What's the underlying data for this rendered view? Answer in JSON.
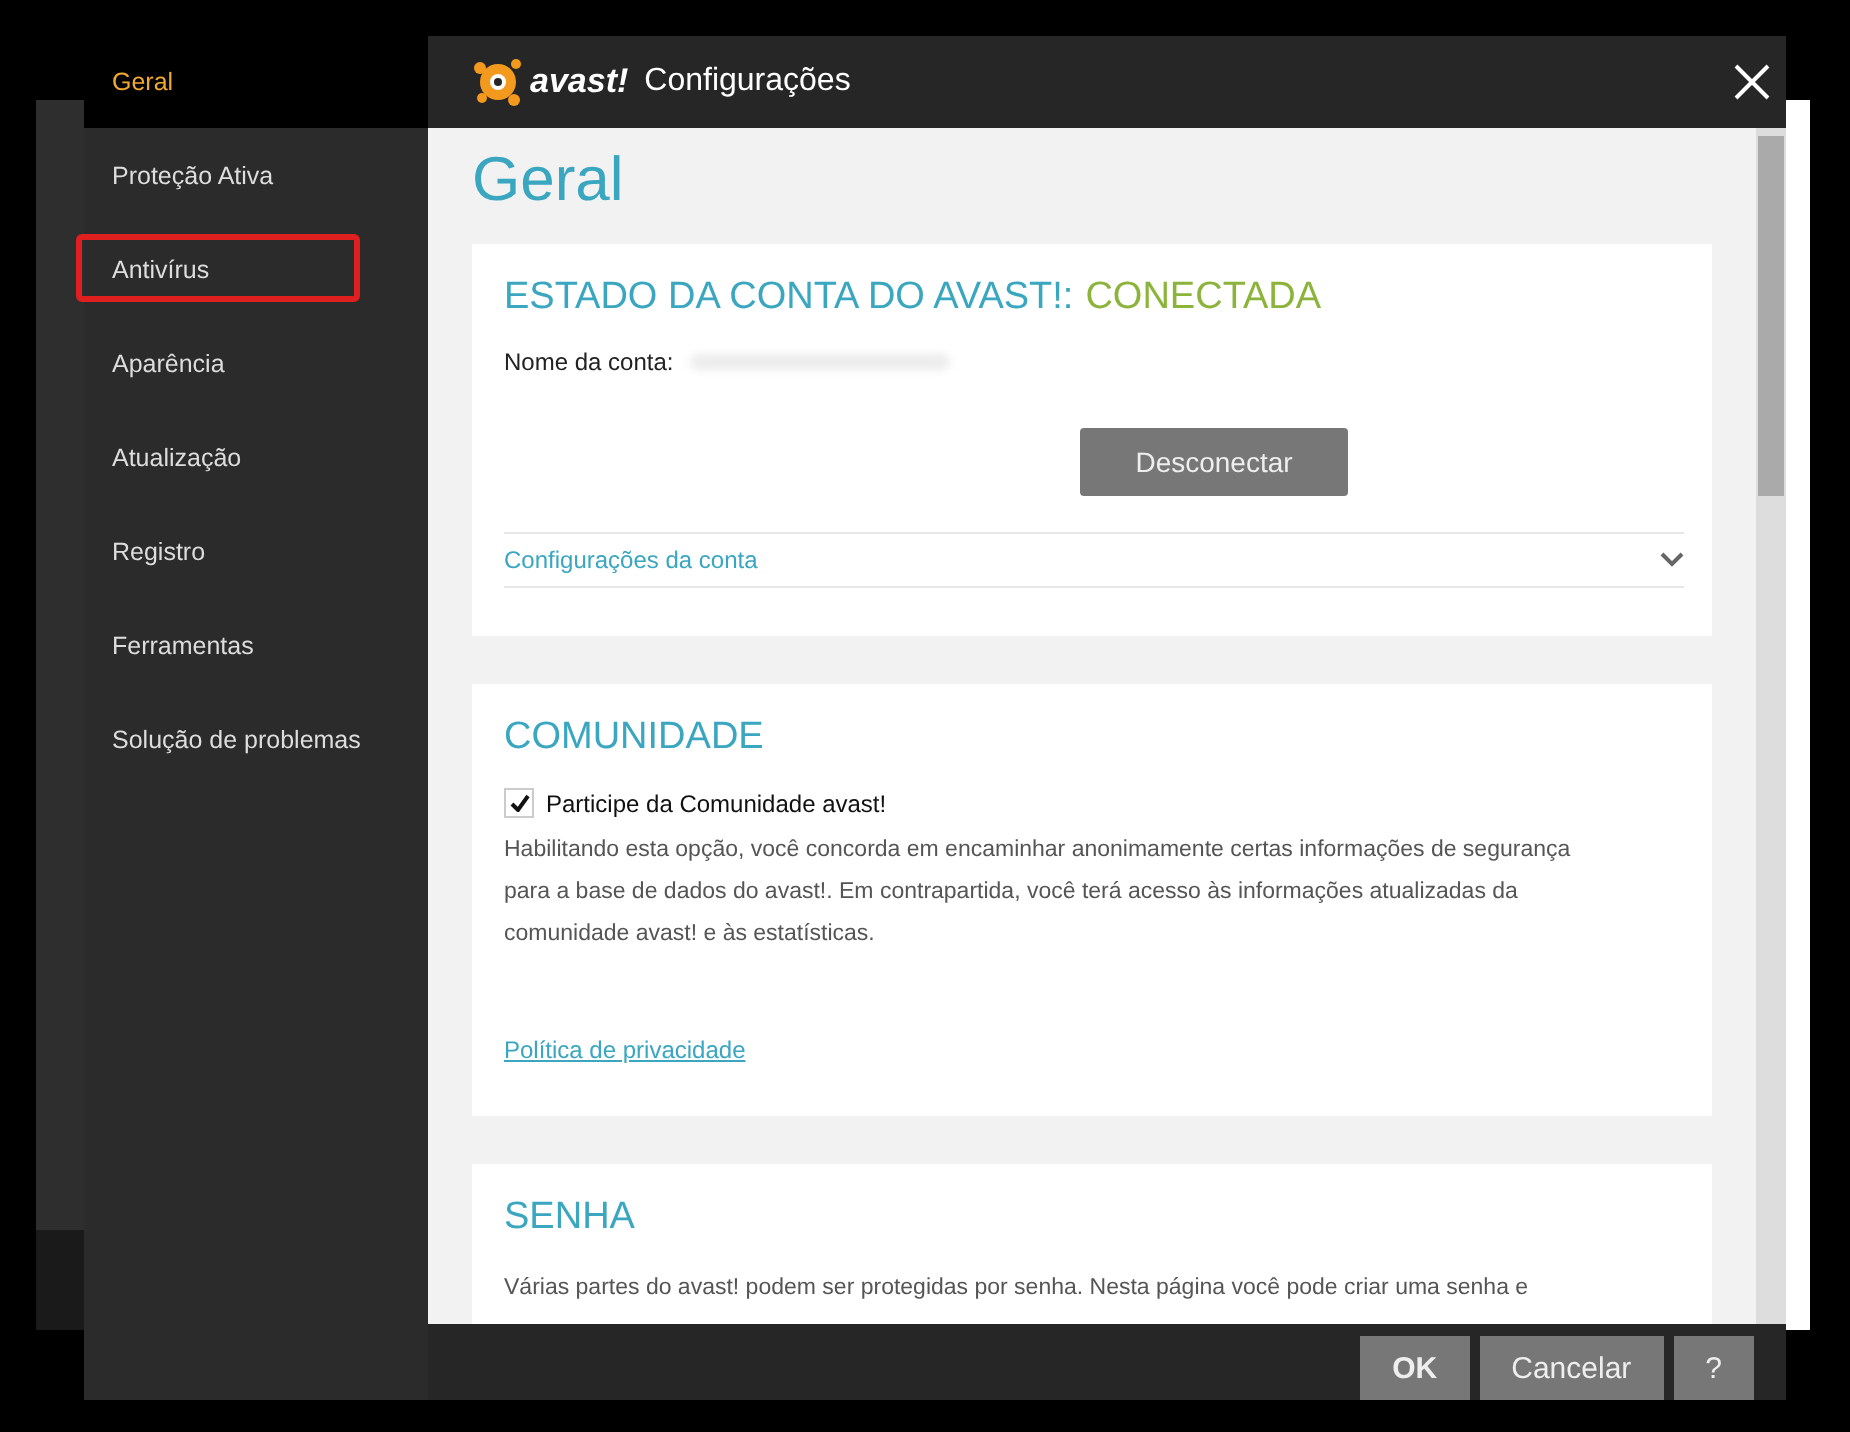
{
  "window": {
    "logo": "avast!",
    "title": "Configurações"
  },
  "sidebar": {
    "items": [
      {
        "label": "Geral",
        "selected": true,
        "highlighted": false
      },
      {
        "label": "Proteção Ativa",
        "selected": false,
        "highlighted": false
      },
      {
        "label": "Antivírus",
        "selected": false,
        "highlighted": true
      },
      {
        "label": "Aparência",
        "selected": false,
        "highlighted": false
      },
      {
        "label": "Atualização",
        "selected": false,
        "highlighted": false
      },
      {
        "label": "Registro",
        "selected": false,
        "highlighted": false
      },
      {
        "label": "Ferramentas",
        "selected": false,
        "highlighted": false
      },
      {
        "label": "Solução de problemas",
        "selected": false,
        "highlighted": false
      }
    ]
  },
  "page_title": "Geral",
  "sections": [
    {
      "kind": "account",
      "heading": "ESTADO DA CONTA DO AVAST!:",
      "status": "CONECTADA",
      "field_label": "Nome da conta:",
      "button": "Desconectar",
      "expander": {
        "label": "Configurações da conta",
        "expanded": false
      }
    },
    {
      "kind": "community",
      "heading": "COMUNIDADE",
      "checkbox": {
        "label": "Participe da Comunidade avast!",
        "checked": true
      },
      "description": "Habilitando esta opção, você concorda em encaminhar anonimamente certas informações de segurança para a base de dados do avast!. Em contrapartida, você terá acesso às informações atualizadas da comunidade avast! e às estatísticas.",
      "link": "Política de privacidade"
    },
    {
      "kind": "text",
      "heading": "SENHA",
      "description": "Várias partes do avast! podem ser protegidas por senha. Nesta página você pode criar uma senha e"
    }
  ],
  "footer": {
    "buttons": [
      {
        "label": "OK",
        "kind": "primary"
      },
      {
        "label": "Cancelar",
        "kind": "normal"
      },
      {
        "label": "?",
        "kind": "normal"
      }
    ]
  }
}
